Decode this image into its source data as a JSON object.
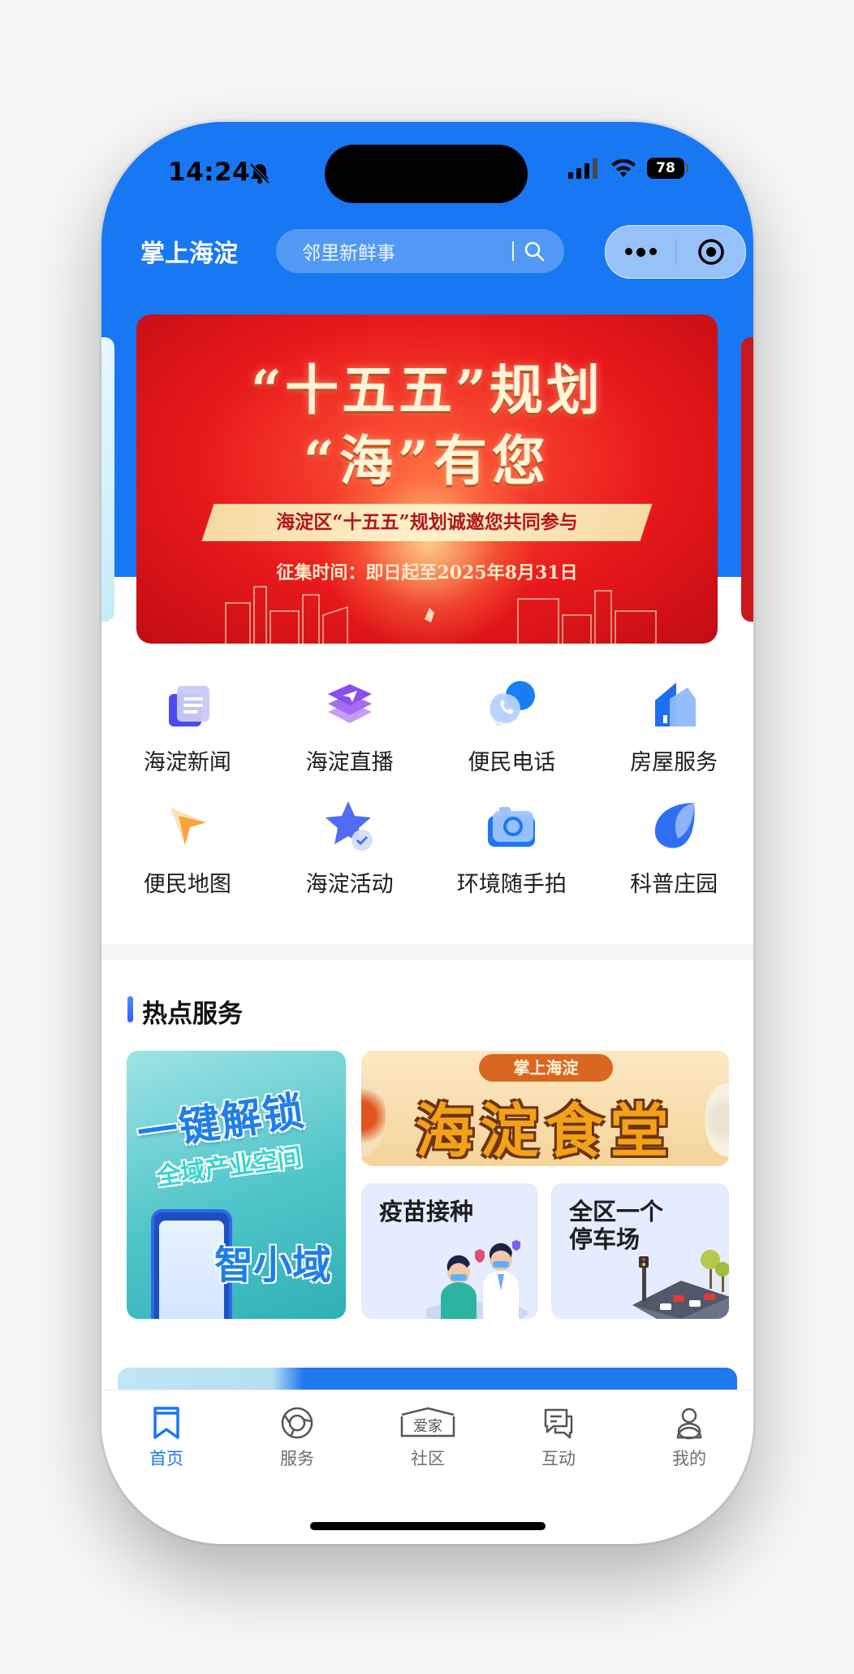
{
  "status": {
    "time": "14:24",
    "battery": "78"
  },
  "header": {
    "app_title": "掌上海淀",
    "search_placeholder": "邻里新鲜事"
  },
  "banner": {
    "line1": "“十五五”规划",
    "line2": "“海”有您",
    "ribbon": "海淀区“十五五”规划诚邀您共同参与",
    "sub": "征集时间：即日起至2025年8月31日"
  },
  "grid": [
    {
      "label": "海淀新闻",
      "icon": "news-icon"
    },
    {
      "label": "海淀直播",
      "icon": "live-icon"
    },
    {
      "label": "便民电话",
      "icon": "phone-icon"
    },
    {
      "label": "房屋服务",
      "icon": "house-icon"
    },
    {
      "label": "便民地图",
      "icon": "map-pointer-icon"
    },
    {
      "label": "海淀活动",
      "icon": "star-icon"
    },
    {
      "label": "环境随手拍",
      "icon": "camera-icon"
    },
    {
      "label": "科普庄园",
      "icon": "leaf-icon"
    }
  ],
  "hot_services": {
    "title": "热点服务",
    "suo": {
      "line1": "一键解锁",
      "line2": "全域产业空间",
      "name": "智小域"
    },
    "food": {
      "tag": "掌上海淀",
      "title": "海淀食堂"
    },
    "vaccine": {
      "label": "疫苗接种"
    },
    "parking": {
      "label_line1": "全区一个",
      "label_line2": "停车场"
    }
  },
  "tabs": [
    {
      "label": "首页",
      "icon": "bookmark-icon",
      "active": true
    },
    {
      "label": "服务",
      "icon": "ring-icon",
      "active": false
    },
    {
      "label": "社区",
      "icon": "aijia-logo-icon",
      "active": false
    },
    {
      "label": "互动",
      "icon": "chat-icon",
      "active": false
    },
    {
      "label": "我的",
      "icon": "user-icon",
      "active": false
    }
  ],
  "colors": {
    "brand": "#1877f2",
    "banner_red": "#e8191c"
  }
}
